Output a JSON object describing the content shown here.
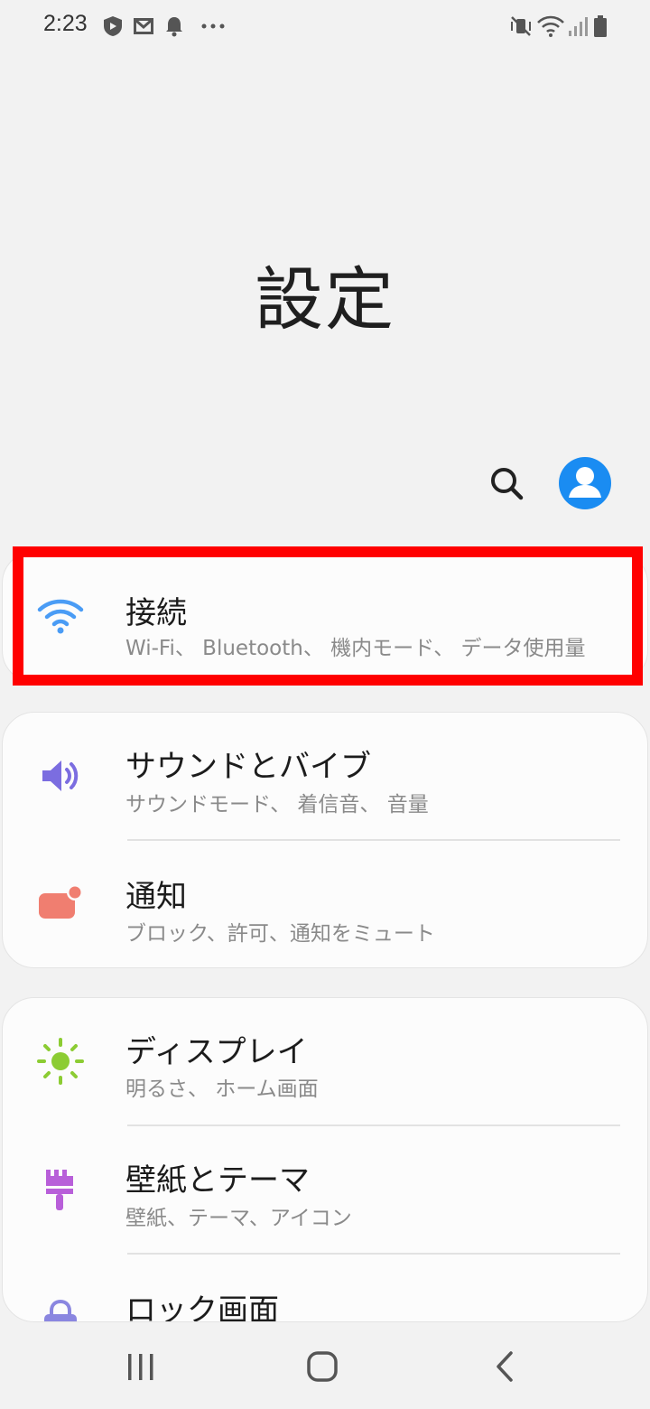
{
  "status_bar": {
    "time": "2:23",
    "left_icons": [
      "shield-icon",
      "gmail-icon",
      "bell-icon",
      "more-dots-icon"
    ],
    "right_icons": [
      "mute-vibrate-icon",
      "wifi-icon",
      "signal-icon",
      "battery-icon"
    ]
  },
  "header": {
    "title": "設定"
  },
  "actions": {
    "search_icon": "search-icon",
    "account_icon": "account-icon"
  },
  "colors": {
    "accent": "#1a8cf2",
    "highlight": "#ff0000",
    "wifi": "#4a9cf5",
    "sound": "#7b6de0",
    "notifications": "#f07e70",
    "display": "#8ccc33",
    "wallpaper": "#b85fd9",
    "lock": "#8a86e0"
  },
  "sections": [
    {
      "items": [
        {
          "icon": "wifi-icon",
          "title": "接続",
          "subtitle": "Wi-Fi、 Bluetooth、 機内モード、 データ使用量",
          "highlighted": true
        }
      ]
    },
    {
      "items": [
        {
          "icon": "speaker-icon",
          "title": "サウンドとバイブ",
          "subtitle": "サウンドモード、 着信音、 音量"
        },
        {
          "icon": "notification-icon",
          "title": "通知",
          "subtitle": "ブロック、許可、通知をミュート"
        }
      ]
    },
    {
      "items": [
        {
          "icon": "sun-icon",
          "title": "ディスプレイ",
          "subtitle": "明るさ、 ホーム画面"
        },
        {
          "icon": "paint-brush-icon",
          "title": "壁紙とテーマ",
          "subtitle": "壁紙、テーマ、アイコン"
        },
        {
          "icon": "lock-icon",
          "title": "ロック画面"
        }
      ]
    }
  ],
  "nav_bar": {
    "buttons": [
      "recent-apps-icon",
      "home-icon",
      "back-icon"
    ]
  }
}
